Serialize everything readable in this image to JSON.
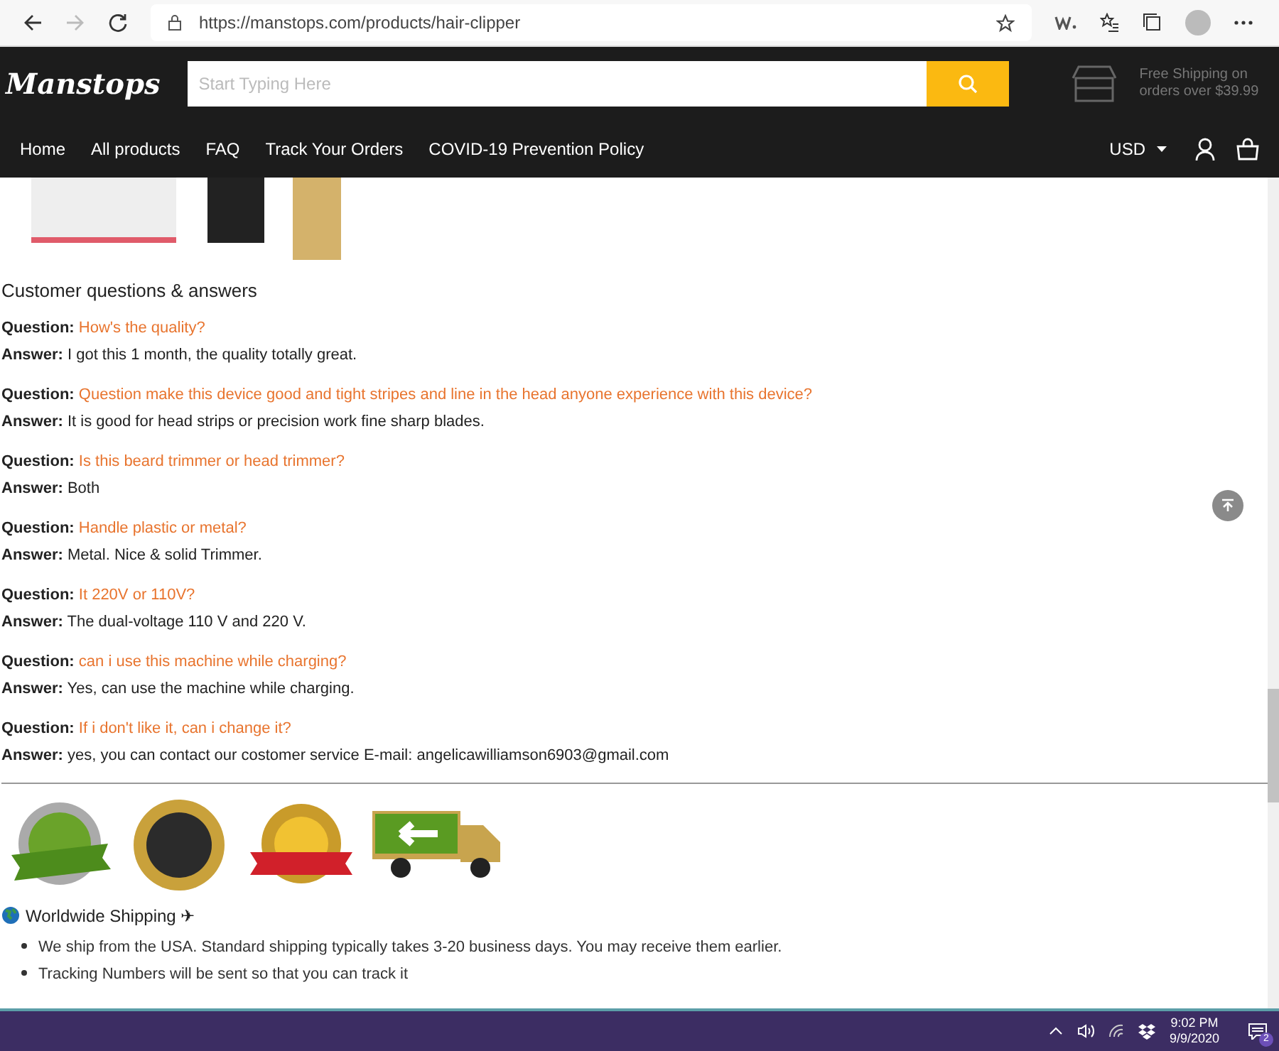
{
  "browser": {
    "url": "https://manstops.com/products/hair-clipper"
  },
  "header": {
    "logo": "Manstops",
    "search_placeholder": "Start Typing Here",
    "shipping_note": [
      "Free Shipping on",
      "orders over $39.99"
    ]
  },
  "nav": {
    "items": [
      "Home",
      "All products",
      "FAQ",
      "Track Your Orders",
      "COVID-19 Prevention Policy"
    ],
    "currency": "USD"
  },
  "qa": {
    "title": "Customer questions & answers",
    "items": [
      {
        "question_label": "Question:",
        "question": "How's the quality?",
        "answer_label": "Answer:",
        "answer": "I got this 1 month, the quality totally great."
      },
      {
        "question_label": "Question:",
        "question": "Question make this device good and tight stripes and line in the head anyone experience with this device?",
        "answer_label": "Answer:",
        "answer": "It is good for head strips or precision work fine sharp blades."
      },
      {
        "question_label": "Question:",
        "question": "Is this beard trimmer or head trimmer?",
        "answer_label": "Answer:",
        "answer": "Both"
      },
      {
        "question_label": "Question:",
        "question": "Handle plastic or metal?",
        "answer_label": "Answer:",
        "answer": "Metal. Nice & solid Trimmer."
      },
      {
        "question_label": "Question:",
        "question": "It 220V or 110V?",
        "answer_label": "Answer:",
        "answer": "The dual-voltage 110 V and 220 V."
      },
      {
        "question_label": "Question:",
        "question": "can i use this machine while charging?",
        "answer_label": "Answer:",
        "answer": "Yes, can use the machine while charging."
      },
      {
        "question_label": "Question:",
        "question": "If i don't like it, can i change it?",
        "answer_label": "Answer:",
        "answer": "yes, you can contact our costomer service E-mail: angelicawilliamson6903@gmail.com"
      }
    ]
  },
  "shipping": {
    "title": "Worldwide Shipping ✈",
    "bullets": [
      "We ship from the USA. Standard shipping typically takes 3-20 business days. You may receive them earlier.",
      "Tracking Numbers will be sent so that you can track it"
    ]
  },
  "taskbar": {
    "time": "9:02 PM",
    "date": "9/9/2020",
    "notification_count": "2"
  }
}
